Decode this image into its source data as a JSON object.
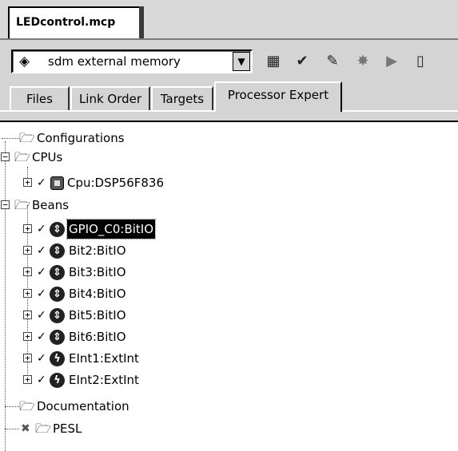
{
  "window": {
    "tab_title": "LEDcontrol.mcp"
  },
  "toolbar": {
    "target": {
      "icon": "target-icon",
      "label": "sdm external memory"
    },
    "tools": [
      "settings-icon",
      "check-icon",
      "make-icon",
      "debug-icon",
      "run-icon",
      "device-icon"
    ]
  },
  "tabs": [
    {
      "label": "Files"
    },
    {
      "label": "Link Order"
    },
    {
      "label": "Targets"
    },
    {
      "label": "Processor Expert",
      "active": true
    }
  ],
  "tree": {
    "configurations": "Configurations",
    "cpus": "CPUs",
    "cpu_item": "Cpu:DSP56F836",
    "beans": "Beans",
    "bean_items": [
      {
        "label": "GPIO_C0:BitIO",
        "icon": "bitio-icon",
        "selected": true
      },
      {
        "label": "Bit2:BitIO",
        "icon": "bitio-icon"
      },
      {
        "label": "Bit3:BitIO",
        "icon": "bitio-icon"
      },
      {
        "label": "Bit4:BitIO",
        "icon": "bitio-icon"
      },
      {
        "label": "Bit5:BitIO",
        "icon": "bitio-icon"
      },
      {
        "label": "Bit6:BitIO",
        "icon": "bitio-icon"
      },
      {
        "label": "EInt1:ExtInt",
        "icon": "extint-icon"
      },
      {
        "label": "EInt2:ExtInt",
        "icon": "extint-icon"
      }
    ],
    "documentation": "Documentation",
    "pesl": "PESL"
  }
}
